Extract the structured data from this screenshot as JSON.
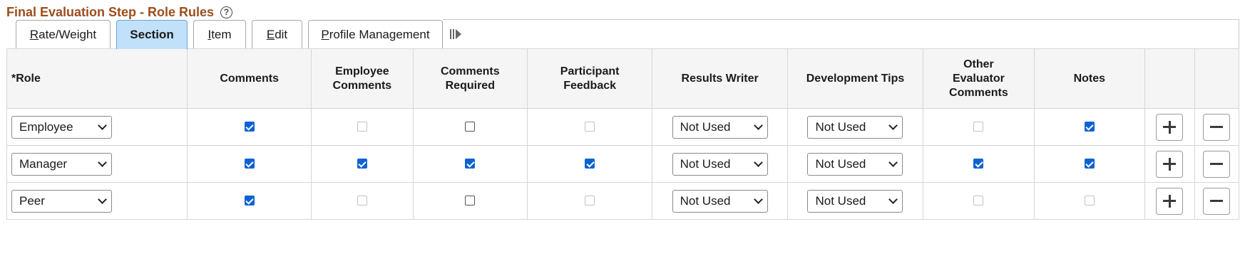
{
  "page": {
    "title": "Final Evaluation Step - Role Rules",
    "help_glyph": "?"
  },
  "tabs": [
    {
      "label_first": "R",
      "label_rest": "ate/Weight",
      "active": false
    },
    {
      "label_first": "",
      "label_rest": "Section",
      "active": true
    },
    {
      "label_first": "I",
      "label_rest": "tem",
      "active": false
    },
    {
      "label_first": "E",
      "label_rest": "dit",
      "active": false
    },
    {
      "label_first": "P",
      "label_rest": "rofile Management",
      "active": false
    }
  ],
  "columns": {
    "role": "*Role",
    "comments": "Comments",
    "employee_comments_1": "Employee",
    "employee_comments_2": "Comments",
    "comments_required_1": "Comments",
    "comments_required_2": "Required",
    "participant_feedback_1": "Participant",
    "participant_feedback_2": "Feedback",
    "results_writer": "Results Writer",
    "development_tips": "Development Tips",
    "other_eval_1": "Other",
    "other_eval_2": "Evaluator",
    "other_eval_3": "Comments",
    "notes": "Notes"
  },
  "rows": [
    {
      "role": "Employee",
      "comments": "checked",
      "employee_comments": "disabled",
      "comments_required": "unchecked",
      "participant_feedback": "disabled",
      "results_writer": "Not Used",
      "development_tips": "Not Used",
      "other_evaluator_comments": "disabled",
      "notes": "checked"
    },
    {
      "role": "Manager",
      "comments": "checked",
      "employee_comments": "checked",
      "comments_required": "checked",
      "participant_feedback": "checked",
      "results_writer": "Not Used",
      "development_tips": "Not Used",
      "other_evaluator_comments": "checked",
      "notes": "checked"
    },
    {
      "role": "Peer",
      "comments": "checked",
      "employee_comments": "disabled",
      "comments_required": "unchecked",
      "participant_feedback": "disabled",
      "results_writer": "Not Used",
      "development_tips": "Not Used",
      "other_evaluator_comments": "disabled",
      "notes": "disabled"
    }
  ],
  "colors": {
    "title": "#9c4d1d",
    "active_tab": "#c1e0f9",
    "checkbox_checked": "#0b63d3",
    "header_bg": "#f5f5f5"
  },
  "icons": {
    "help": "help-circle-icon",
    "more_tabs": "show-more-tabs-icon",
    "add_row": "plus-icon",
    "delete_row": "minus-icon",
    "dropdown": "chevron-down-icon"
  }
}
